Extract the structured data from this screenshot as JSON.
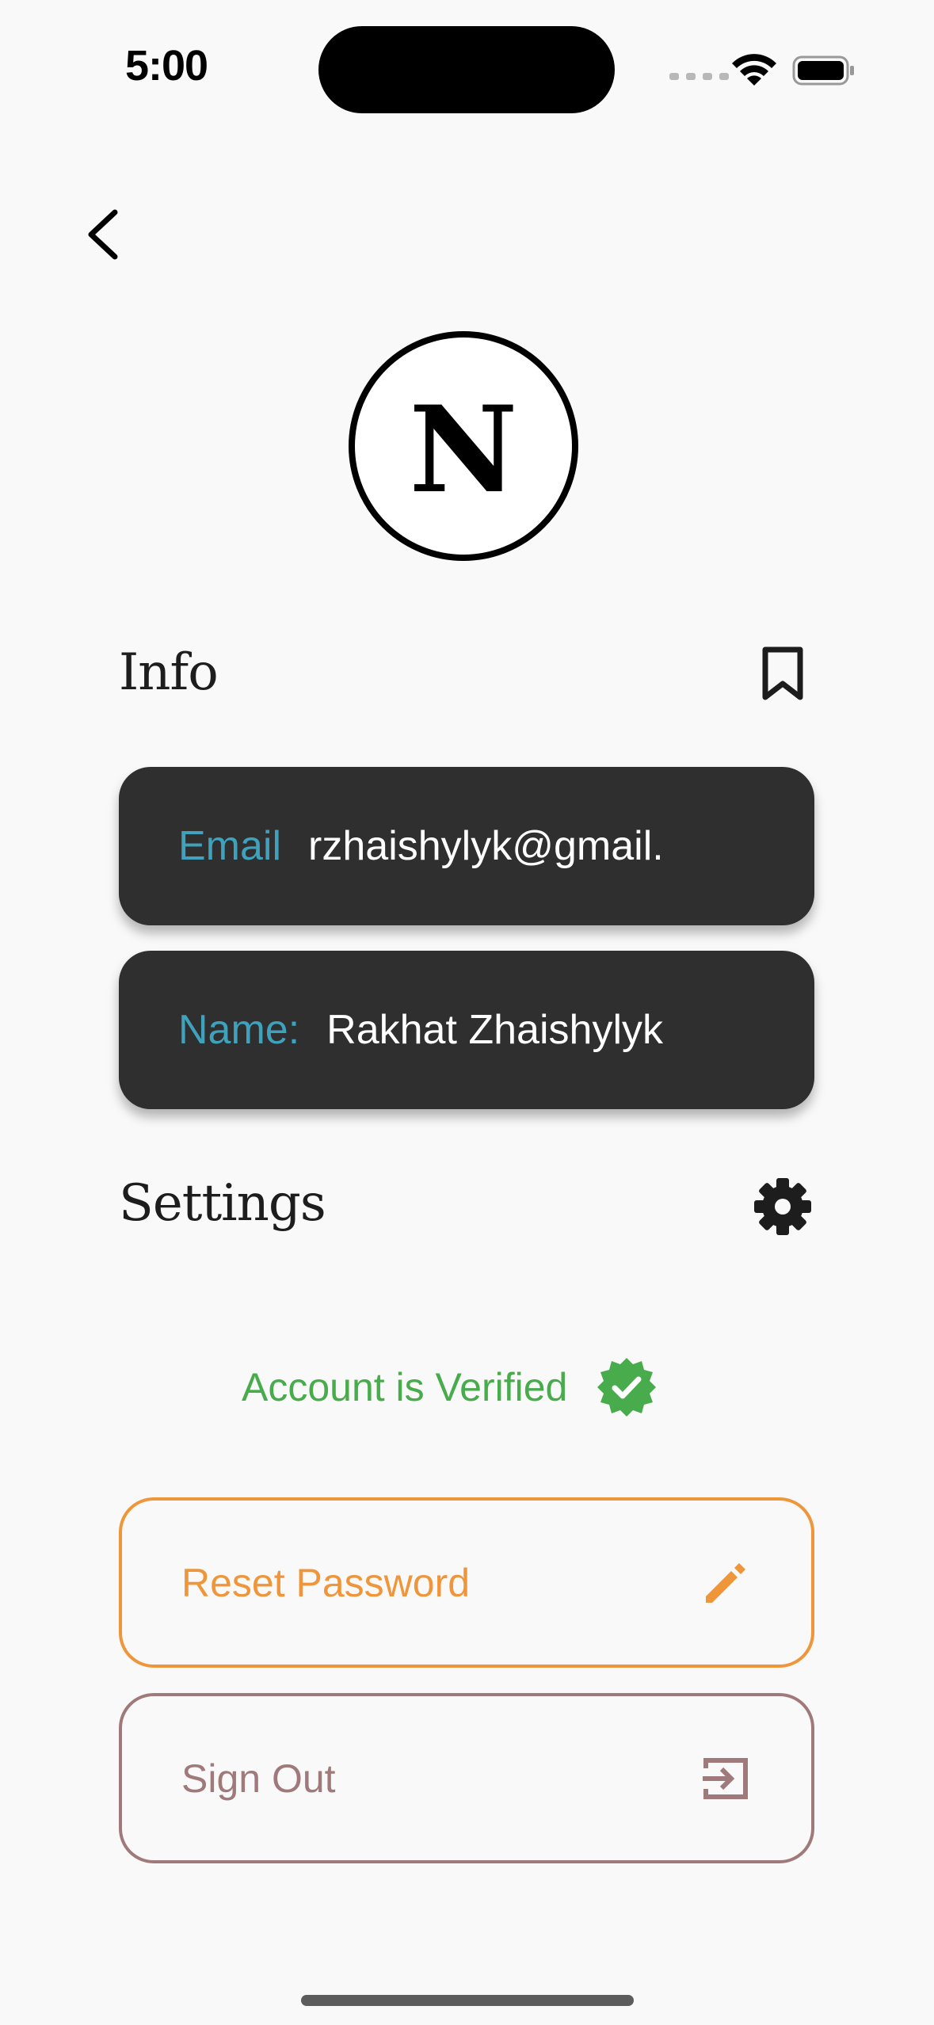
{
  "status_bar": {
    "time": "5:00"
  },
  "profile": {
    "avatar_letter": "N"
  },
  "info": {
    "title": "Info",
    "email_label": "Email",
    "email_value": "rzhaishylyk@gmail.",
    "name_label": "Name:",
    "name_value": "Rakhat Zhaishylyk"
  },
  "settings": {
    "title": "Settings",
    "verified_text": "Account is Verified",
    "reset_label": "Reset Password",
    "signout_label": "Sign Out"
  },
  "icons": {
    "back": "chevron-left-icon",
    "bookmark": "bookmark-icon",
    "settings": "gear-icon",
    "verified": "verified-badge-icon",
    "reset": "pencil-icon",
    "signout": "logout-icon"
  },
  "colors": {
    "card_bg": "#2f2f2f",
    "label_accent": "#3ea2bd",
    "verified": "#48ab4c",
    "reset": "#f0963a",
    "signout": "#a07a7a"
  }
}
